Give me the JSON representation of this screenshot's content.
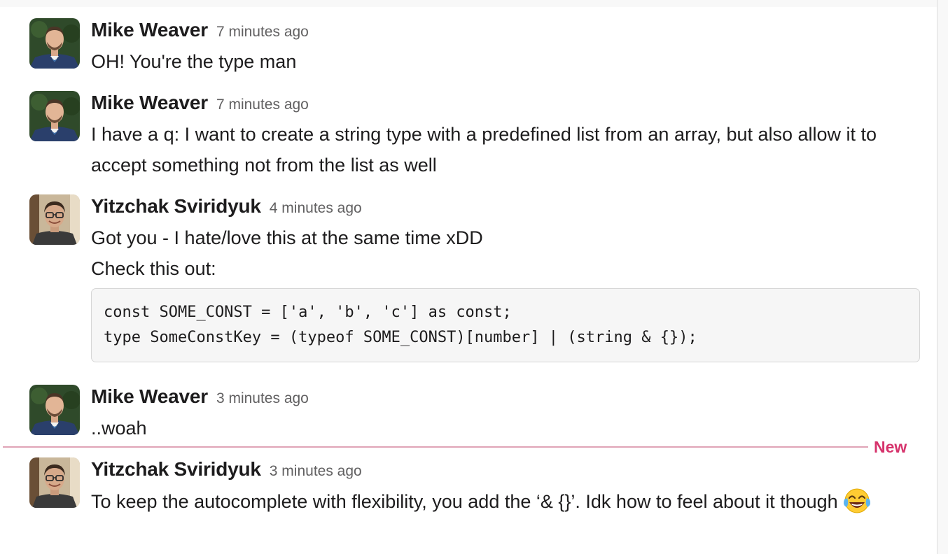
{
  "messages": [
    {
      "author": "Mike Weaver",
      "time": "7 minutes ago",
      "avatar": "mike-avatar",
      "lines": [
        "OH! You're the type man"
      ]
    },
    {
      "author": "Mike Weaver",
      "time": "7 minutes ago",
      "avatar": "mike-avatar",
      "lines": [
        "I have a q: I want to create a string type with a predefined list from an array, but also allow it to accept something not from the list as well"
      ]
    },
    {
      "author": "Yitzchak Sviridyuk",
      "time": "4 minutes ago",
      "avatar": "yitzchak-avatar",
      "lines": [
        "Got you - I hate/love this at the same time xDD",
        "Check this out:"
      ],
      "code": [
        "const SOME_CONST = ['a', 'b', 'c'] as const;",
        "type SomeConstKey = (typeof SOME_CONST)[number] | (string & {});"
      ]
    },
    {
      "author": "Mike Weaver",
      "time": "3 minutes ago",
      "avatar": "mike-avatar",
      "lines": [
        "..woah"
      ]
    },
    {
      "author": "Yitzchak Sviridyuk",
      "time": "3 minutes ago",
      "avatar": "yitzchak-avatar",
      "lines": [
        "To keep the autocomplete with flexibility, you add the ‘& {}’. Idk how to feel about it though"
      ],
      "emoji": "tears-of-joy-emoji"
    }
  ],
  "divider": {
    "label": "New"
  },
  "colors": {
    "new_accent": "#d6336c",
    "text": "#1d1c1d",
    "muted": "#616061"
  }
}
